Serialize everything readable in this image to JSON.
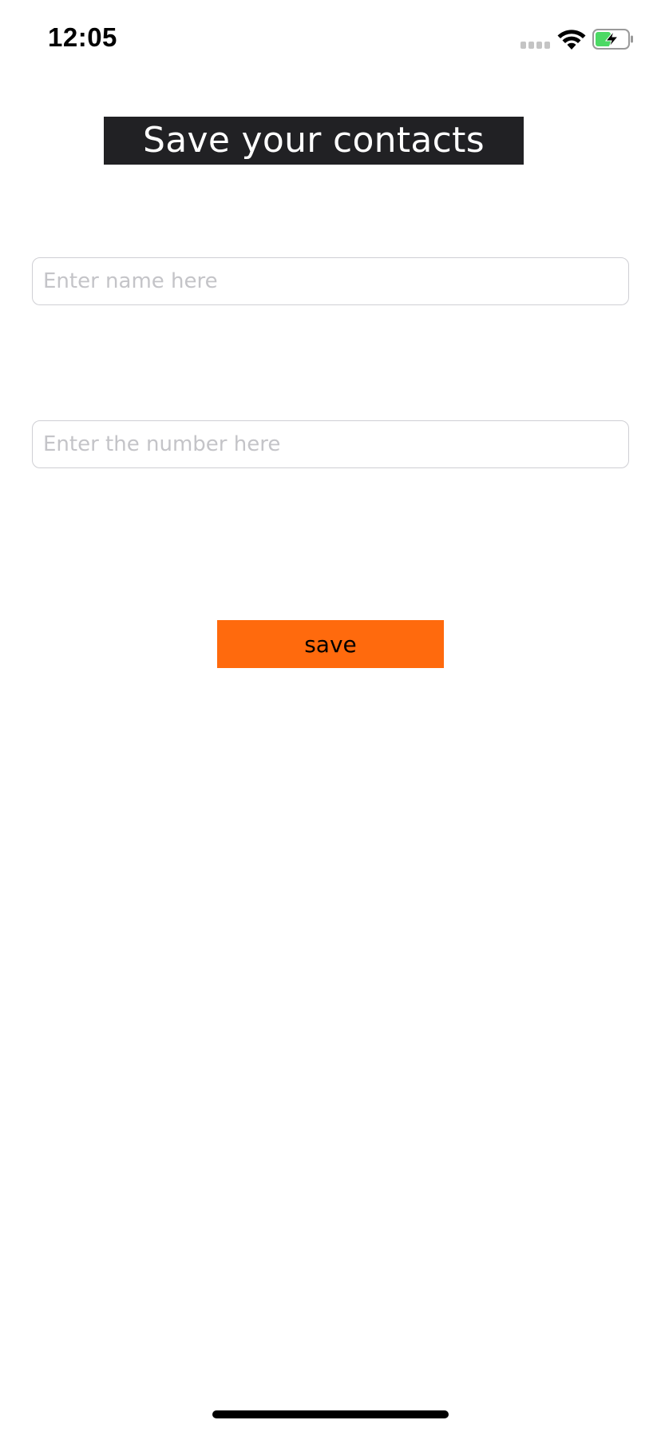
{
  "status_bar": {
    "time": "12:05",
    "signal_icon": "cellular-signal-icon",
    "wifi_icon": "wifi-icon",
    "battery_icon": "battery-charging-icon",
    "battery_color": "#4cd964"
  },
  "header": {
    "title": "Save your contacts",
    "background_color": "#212124"
  },
  "form": {
    "name_field": {
      "value": "",
      "placeholder": "Enter name here"
    },
    "number_field": {
      "value": "",
      "placeholder": "Enter the number here"
    },
    "save_button": {
      "label": "save",
      "color": "#ff6a0d"
    }
  }
}
